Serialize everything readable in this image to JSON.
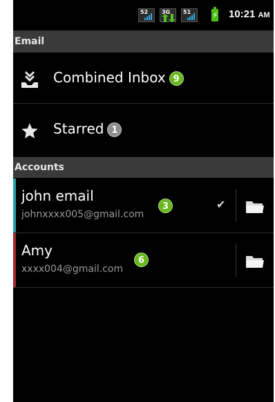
{
  "status_bar": {
    "signal_1": "52",
    "signal_2": "3G",
    "signal_3": "51",
    "time": "10:21",
    "ampm": "AM"
  },
  "sections": {
    "email": "Email",
    "accounts": "Accounts"
  },
  "mailboxes": [
    {
      "label": "Combined Inbox",
      "badge": "9",
      "icon": "inbox-download-icon",
      "badge_color": "#68b81c"
    },
    {
      "label": "Starred",
      "badge": "1",
      "icon": "star-icon",
      "badge_color": "#8e8e8e"
    }
  ],
  "accounts": [
    {
      "name": "john email",
      "address": "johnxxxx005@gmail.com",
      "unread": "3",
      "selected": true,
      "color": "#2aa0a8"
    },
    {
      "name": "Amy",
      "address": "xxxx004@gmail.com",
      "unread": "6",
      "selected": false,
      "color": "#a02a2e"
    }
  ],
  "icons": {
    "check": "checkmark-icon",
    "folder": "folder-icon"
  }
}
